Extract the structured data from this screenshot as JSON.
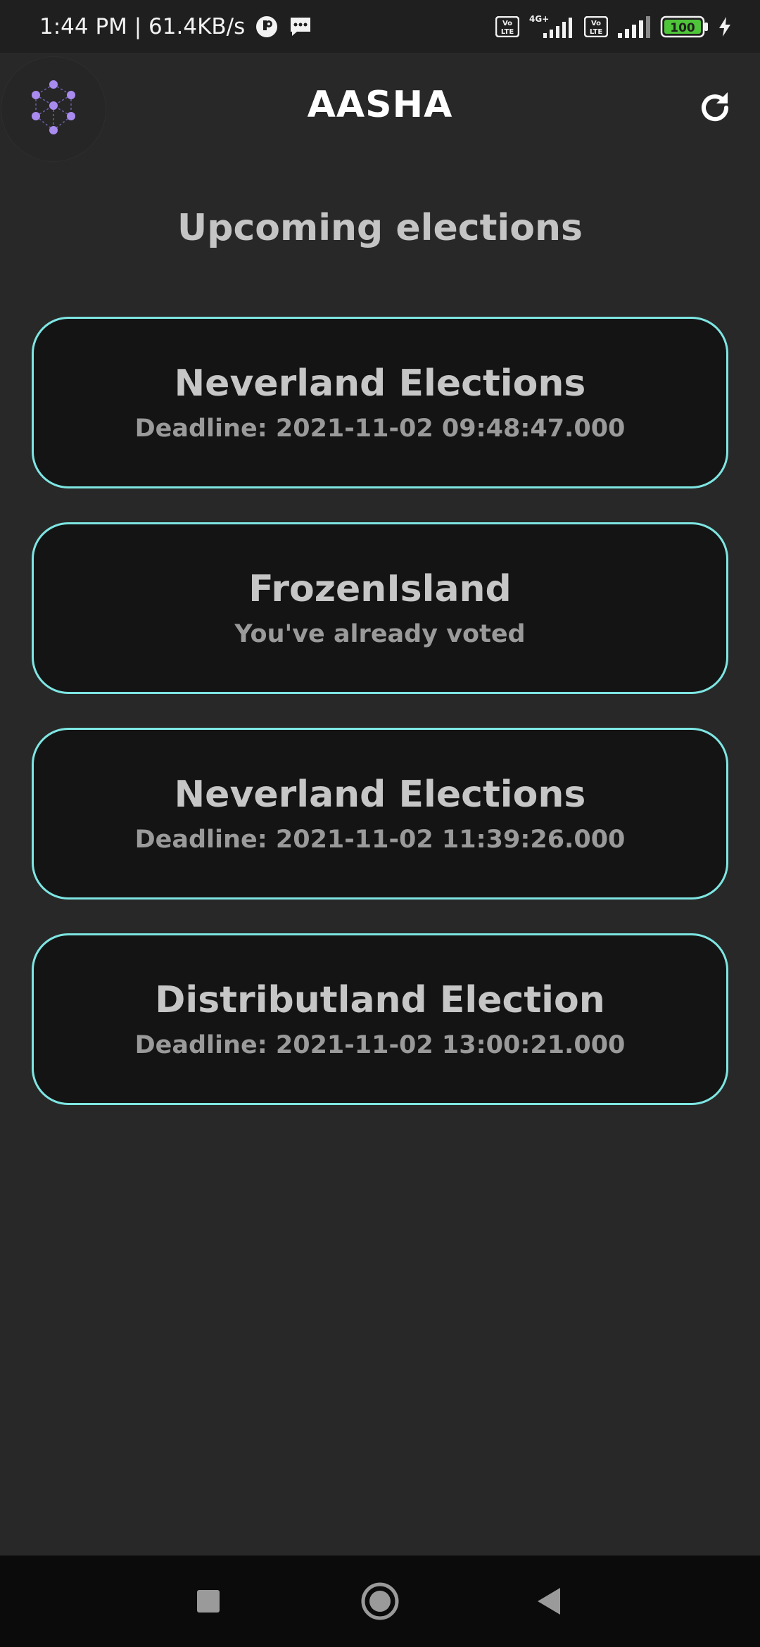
{
  "status_bar": {
    "time_speed": "1:44 PM | 61.4KB/s",
    "network_4g": "4G+",
    "battery": "100"
  },
  "app_bar": {
    "title": "AASHA"
  },
  "page": {
    "heading": "Upcoming elections"
  },
  "elections": [
    {
      "name": "Neverland Elections",
      "status": "Deadline: 2021-11-02 09:48:47.000"
    },
    {
      "name": "FrozenIsland",
      "status": "You've already voted"
    },
    {
      "name": "Neverland Elections",
      "status": "Deadline: 2021-11-02 11:39:26.000"
    },
    {
      "name": "Distributland Election",
      "status": "Deadline: 2021-11-02 13:00:21.000"
    }
  ],
  "colors": {
    "card_border": "#7ee6e3",
    "background": "#282828",
    "card_background": "#141414",
    "logo_accent": "#a98bf0"
  },
  "icons": {
    "logo": "hexagon-network-logo-icon",
    "refresh": "refresh-icon",
    "nav_recents": "square-recents-icon",
    "nav_home": "circle-home-icon",
    "nav_back": "triangle-back-icon"
  }
}
